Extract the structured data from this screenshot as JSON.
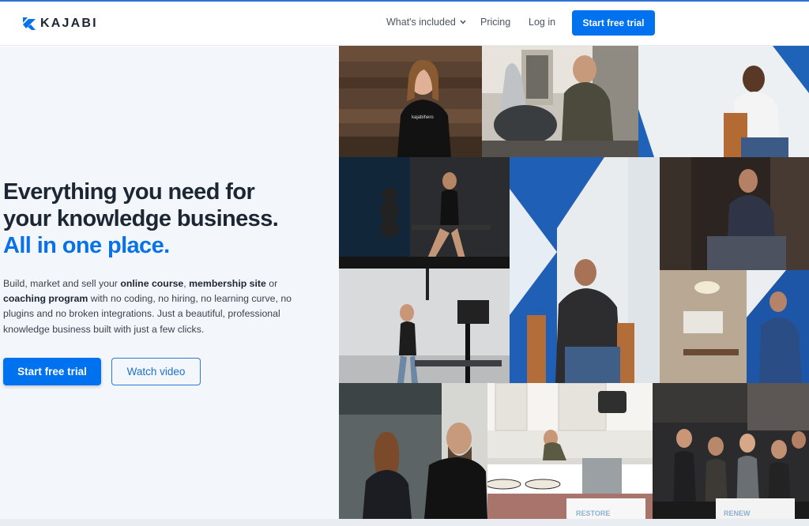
{
  "brand": {
    "name": "KAJABI",
    "color": "#0072ef"
  },
  "nav": {
    "whats_included": "What's included",
    "pricing": "Pricing",
    "login": "Log in",
    "cta": "Start free trial"
  },
  "hero": {
    "headline_line1": "Everything you need for",
    "headline_line2": "your knowledge business.",
    "headline_line3": "All in one place.",
    "body_1": "Build, market and sell your ",
    "body_b1": "online course",
    "body_2": ", ",
    "body_b2": "membership site",
    "body_3": " or ",
    "body_b3": "coaching program",
    "body_4": " with no coding, no hiring, no learning curve, no plugins and no broken integrations. Just a beautiful, professional knowledge business built with just a few clicks.",
    "primary_cta": "Start free trial",
    "secondary_cta": "Watch video"
  },
  "mosaic": {
    "sign_left": "RESTORE",
    "sign_right": "RENEW",
    "shirt_text": "kajabihero"
  },
  "icons": [
    "kajabi-logo-icon",
    "chevron-down-icon"
  ]
}
